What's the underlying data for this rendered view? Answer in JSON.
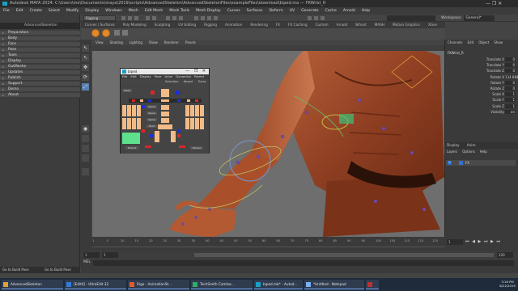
{
  "titlebar": {
    "text": "Autodesk MAYA 2024: C:\\Users\\me\\Documents\\maya\\2019\\scripts\\AdvancedSkeleton\\AdvancedSkeletonFiles\\exampleFiles\\download\\biped.ma  ---  FKWrist_R",
    "controls": "—   ❐   ✕"
  },
  "menubar": [
    "File",
    "Edit",
    "Create",
    "Select",
    "Modify",
    "Display",
    "Windows",
    "Mesh",
    "Edit Mesh",
    "Mesh Tools",
    "Mesh Display",
    "Curves",
    "Surfaces",
    "Deform",
    "UV",
    "Generate",
    "Cache",
    "Arnold",
    "Help"
  ],
  "statusline": {
    "mode": "Rigging",
    "search_placeholder": "",
    "workspace_label": "Workspace:",
    "workspace_value": "General*"
  },
  "shelf_tabs": [
    {
      "label": "Curves / Surfaces",
      "active": false
    },
    {
      "label": "Poly Modeling",
      "active": false
    },
    {
      "label": "Sculpting",
      "active": false
    },
    {
      "label": "UV Editing",
      "active": false
    },
    {
      "label": "Rigging",
      "active": false
    },
    {
      "label": "Animation",
      "active": false
    },
    {
      "label": "Rendering",
      "active": false
    },
    {
      "label": "FX",
      "active": false
    },
    {
      "label": "FX Caching",
      "active": false
    },
    {
      "label": "Custom",
      "active": false
    },
    {
      "label": "Arnold",
      "active": false
    },
    {
      "label": "Bifrost",
      "active": false
    },
    {
      "label": "MASH",
      "active": false
    },
    {
      "label": "Motion Graphics",
      "active": false
    },
    {
      "label": "XGen",
      "active": false
    },
    {
      "label": "AdvSkel",
      "active": true
    },
    {
      "label": "TURTLE",
      "active": false
    }
  ],
  "left_panel": {
    "header": "AdvancedSkeleton",
    "items": [
      "Preparation",
      "Body",
      "Face",
      "Pose",
      "Tools",
      "Display",
      "OutMeshe",
      "Updates",
      "Publish",
      "Support",
      "Demo",
      "About"
    ],
    "bottom_left": "Go to Build Pose",
    "bottom_right": "Go to Build Pose"
  },
  "tools": [
    "↖",
    "↖",
    "✥",
    "⟳",
    "⤢",
    "◉"
  ],
  "viewport_menu": [
    "View",
    "Shading",
    "Lighting",
    "Show",
    "Renderer",
    "Panels"
  ],
  "right_panel": {
    "tabs": [
      "Channels",
      "Edit",
      "Object",
      "Show"
    ],
    "object_name": "FKWrist_R",
    "attributes": [
      {
        "label": "Translate X",
        "value": "0"
      },
      {
        "label": "Translate Y",
        "value": "0"
      },
      {
        "label": "Translate Z",
        "value": "0"
      },
      {
        "label": "Rotate X",
        "value": "134.884"
      },
      {
        "label": "Rotate Y",
        "value": "0"
      },
      {
        "label": "Rotate Z",
        "value": "0"
      },
      {
        "label": "Scale X",
        "value": "1"
      },
      {
        "label": "Scale Y",
        "value": "1"
      },
      {
        "label": "Scale Z",
        "value": "1"
      },
      {
        "label": "Visibility",
        "value": "on"
      }
    ],
    "layer_tabs": [
      "Display",
      "Anim"
    ],
    "layer_menu": [
      "Layers",
      "Options",
      "Help"
    ],
    "layer_name": "FX"
  },
  "timeline": {
    "ticks": [
      "1",
      "5",
      "10",
      "15",
      "20",
      "25",
      "30",
      "35",
      "40",
      "45",
      "50",
      "55",
      "60",
      "65",
      "70",
      "75",
      "80",
      "85",
      "90",
      "95",
      "100",
      "105",
      "110",
      "115",
      "120"
    ],
    "current_frame": "1",
    "playback": "⏮ ◀ ▶ ⏭ ▶ ⏭"
  },
  "range": {
    "start": "1",
    "inner_start": "1",
    "inner_end": "120",
    "end": "120",
    "extra1": "200",
    "extra2": "No Character Set",
    "extra3": "No Anim Layer",
    "fps": "24 fps"
  },
  "cmdline": {
    "label": "MEL"
  },
  "adv_window": {
    "title": "biped",
    "menu": [
      "File",
      "Edit",
      "Display",
      "Pose",
      "Anim",
      "Dynamics",
      "Parent"
    ],
    "options": [
      "Selection",
      "Keyed",
      "Extra"
    ],
    "labels": [
      "Head",
      "Spine",
      "Spine",
      "Spine",
      "Root"
    ],
    "bottom_labels": [
      "Pinned",
      "Pinned"
    ]
  },
  "taskbar": [
    {
      "label": "AdvancedSkeleton",
      "color": "#e0a030"
    },
    {
      "label": "[Edit4] - UltraEdit 32",
      "color": "#2f7de1"
    },
    {
      "label": "Rigo - AnimationSt...",
      "color": "#e55c2a"
    },
    {
      "label": "TechSmith Camtas...",
      "color": "#2cae66"
    },
    {
      "label": "biped.mb* - Autod...",
      "color": "#19a0c8"
    },
    {
      "label": "*Untitled - Notepad",
      "color": "#7ab0ff"
    },
    {
      "label": "",
      "color": "#c03030"
    }
  ],
  "clock": {
    "time": "3:18 PM",
    "date": "8/22/2019"
  }
}
